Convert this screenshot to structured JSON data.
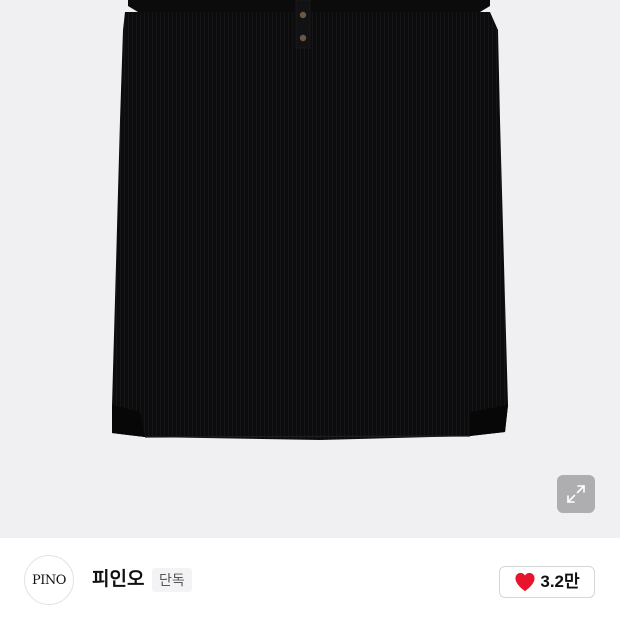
{
  "product_image": {
    "alt": ""
  },
  "expand_control": {
    "icon": "expand-arrows-icon"
  },
  "brand": {
    "logo_text": "PINO",
    "name": "피인오",
    "badge": "단독"
  },
  "like": {
    "icon": "heart-icon",
    "count": "3.2만",
    "heart_color": "#e8132c"
  },
  "colors": {
    "image_background": "#f0f0f2",
    "garment": "#0c0c0d"
  }
}
